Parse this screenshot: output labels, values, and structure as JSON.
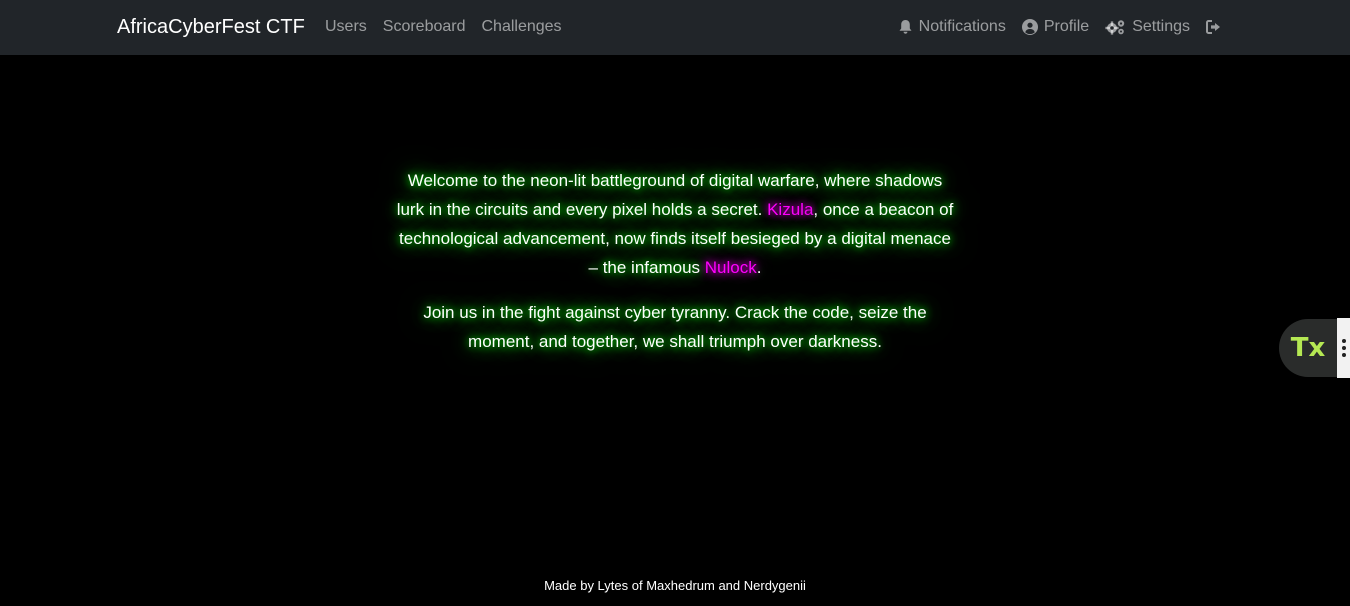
{
  "navbar": {
    "brand": "AfricaCyberFest CTF",
    "links": [
      "Users",
      "Scoreboard",
      "Challenges"
    ],
    "right": {
      "notifications": "Notifications",
      "profile": "Profile",
      "settings": "Settings",
      "logout_icon": "sign-out-icon"
    }
  },
  "content": {
    "p1_a": "Welcome to the neon-lit battleground of digital warfare, where shadows lurk in the circuits and every pixel holds a secret. ",
    "p1_kizula": "Kizula",
    "p1_b": ", once a beacon of technological advancement, now finds itself besieged by a digital menace – the infamous ",
    "p1_nulock": "Nulock",
    "p1_c": ".",
    "p2": "Join us in the fight against cyber tyranny. Crack the code, seize the moment, and together, we shall triumph over darkness."
  },
  "footer": {
    "text": "Made by Lytes of Maxhedrum and Nerdygenii"
  },
  "widget": {
    "label": "Tx"
  },
  "colors": {
    "navbar_bg": "#212529",
    "page_bg": "#000000",
    "glow": "#00ff00",
    "highlight": "#ff00ff",
    "widget_text": "#b5e853"
  }
}
